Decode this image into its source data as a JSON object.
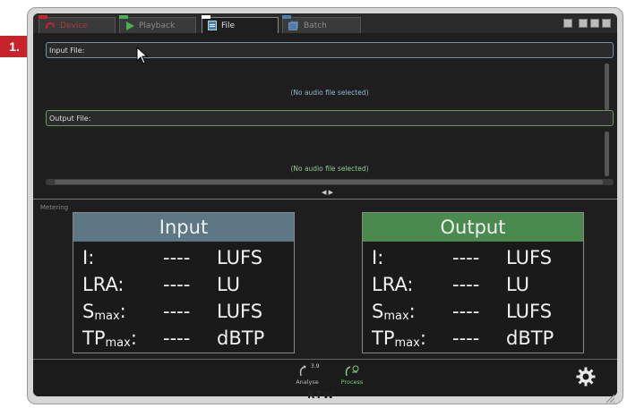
{
  "marker": "1.",
  "tabs": [
    {
      "label": "Device",
      "icon": "device-icon",
      "active": false
    },
    {
      "label": "Playback",
      "icon": "play-icon",
      "active": false
    },
    {
      "label": "File",
      "icon": "file-icon",
      "active": true
    },
    {
      "label": "Batch",
      "icon": "batch-icon",
      "active": false
    }
  ],
  "input_file": {
    "label": "Input File:",
    "status": "(No audio file selected)"
  },
  "output_file": {
    "label": "Output File:",
    "status": "(No audio file selected)"
  },
  "metering": {
    "section_label": "Metering",
    "input": {
      "title": "Input",
      "rows": [
        {
          "label": "I:",
          "value": "----",
          "unit": "LUFS"
        },
        {
          "label": "LRA:",
          "value": "----",
          "unit": "LU"
        },
        {
          "label": "S",
          "sub": "max",
          "suffix": ":",
          "value": "----",
          "unit": "LUFS"
        },
        {
          "label": "TP",
          "sub": "max",
          "suffix": ":",
          "value": "----",
          "unit": "dBTP"
        }
      ]
    },
    "output": {
      "title": "Output",
      "rows": [
        {
          "label": "I:",
          "value": "----",
          "unit": "LUFS"
        },
        {
          "label": "LRA:",
          "value": "----",
          "unit": "LU"
        },
        {
          "label": "S",
          "sub": "max",
          "suffix": ":",
          "value": "----",
          "unit": "LUFS"
        },
        {
          "label": "TP",
          "sub": "max",
          "suffix": ":",
          "value": "----",
          "unit": "dBTP"
        }
      ]
    }
  },
  "bottom": {
    "analyse": {
      "label": "Analyse",
      "version": "3.9"
    },
    "process": {
      "label": "Process"
    }
  },
  "brand": "RTW",
  "colors": {
    "input_accent": "#5e7785",
    "output_accent": "#4b8a4e",
    "marker": "#c8222a"
  }
}
